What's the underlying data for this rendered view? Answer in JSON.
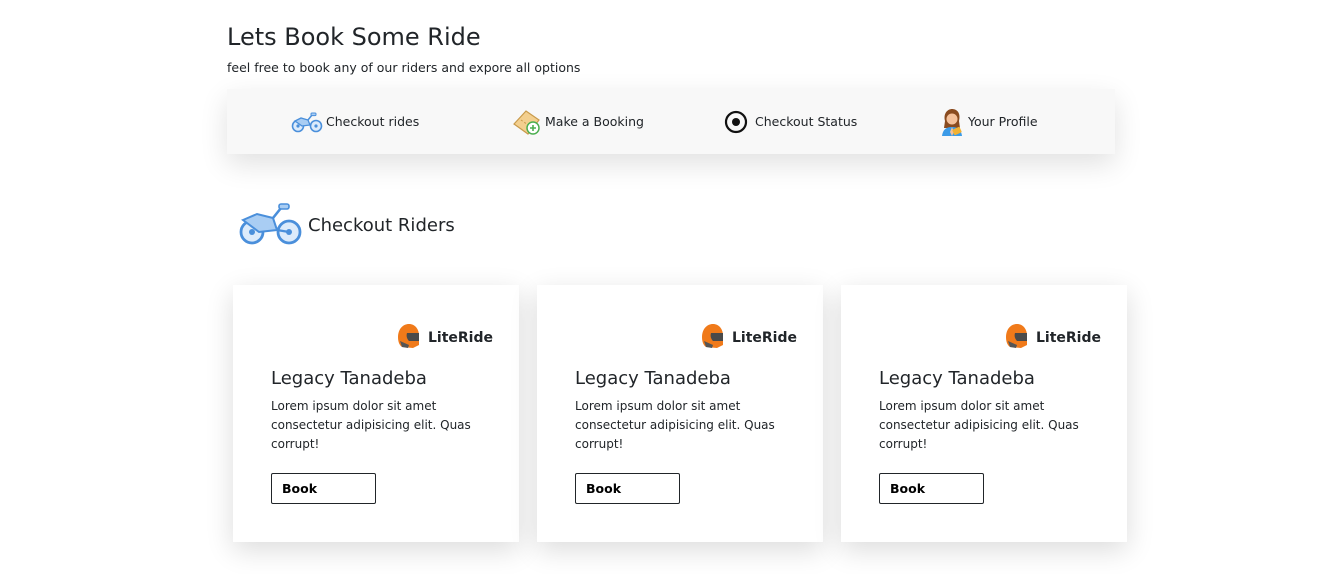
{
  "header": {
    "title": "Lets Book Some Ride",
    "subtitle": "feel free to book any of our riders and expore all options"
  },
  "nav": {
    "items": [
      {
        "label": "Checkout rides",
        "icon": "motorbike-icon"
      },
      {
        "label": "Make a Booking",
        "icon": "ticket-add-icon"
      },
      {
        "label": "Checkout Status",
        "icon": "target-icon"
      },
      {
        "label": "Your Profile",
        "icon": "user-avatar-icon"
      }
    ]
  },
  "section": {
    "title": "Checkout Riders",
    "icon": "motorbike-icon"
  },
  "cards": [
    {
      "brand": "LiteRide",
      "name": "Legacy Tanadeba",
      "description": "Lorem ipsum dolor sit amet consectetur adipisicing elit. Quas corrupt!",
      "button": "Book"
    },
    {
      "brand": "LiteRide",
      "name": "Legacy Tanadeba",
      "description": "Lorem ipsum dolor sit amet consectetur adipisicing elit. Quas corrupt!",
      "button": "Book"
    },
    {
      "brand": "LiteRide",
      "name": "Legacy Tanadeba",
      "description": "Lorem ipsum dolor sit amet consectetur adipisicing elit. Quas corrupt!",
      "button": "Book"
    }
  ],
  "colors": {
    "nav_background": "#f8f8f8",
    "bike_blue": "#5aa0e6",
    "helmet_orange": "#f07a1a",
    "text": "#212529"
  }
}
